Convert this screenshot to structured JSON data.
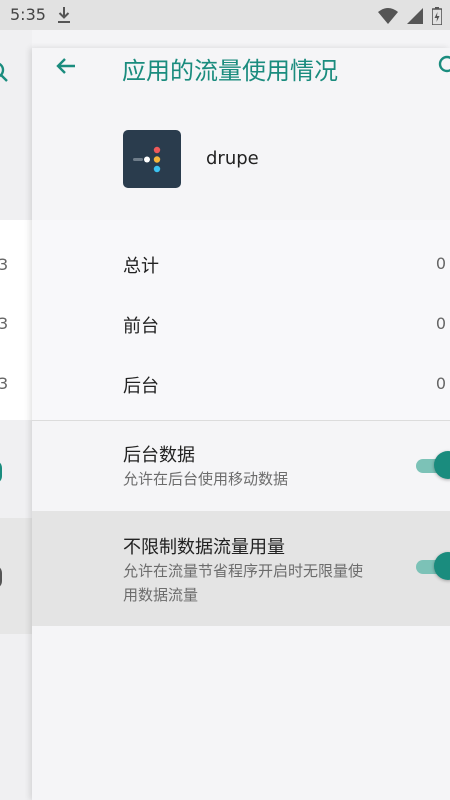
{
  "status_bar": {
    "time": "5:35",
    "icons": [
      "download-icon",
      "wifi-icon",
      "signal-icon",
      "battery-icon"
    ]
  },
  "background_page": {
    "fragments": [
      "3",
      "3",
      "3"
    ]
  },
  "app_bar": {
    "title": "应用的流量使用情况",
    "back_icon": "arrow-left-icon",
    "search_icon": "search-icon"
  },
  "app": {
    "name": "drupe"
  },
  "usage": {
    "rows": [
      {
        "label": "总计",
        "value": "0"
      },
      {
        "label": "前台",
        "value": "0"
      },
      {
        "label": "后台",
        "value": "0"
      }
    ]
  },
  "settings": {
    "background_data": {
      "title": "后台数据",
      "summary": "允许在后台使用移动数据",
      "enabled": true
    },
    "unrestricted_data": {
      "title": "不限制数据流量用量",
      "summary": "允许在流量节省程序开启时无限量使用数据流量",
      "enabled": true
    }
  },
  "colors": {
    "accent": "#1a8c7e",
    "accent_track": "#7cc2b7",
    "app_icon_bg": "#2a3c4d"
  }
}
